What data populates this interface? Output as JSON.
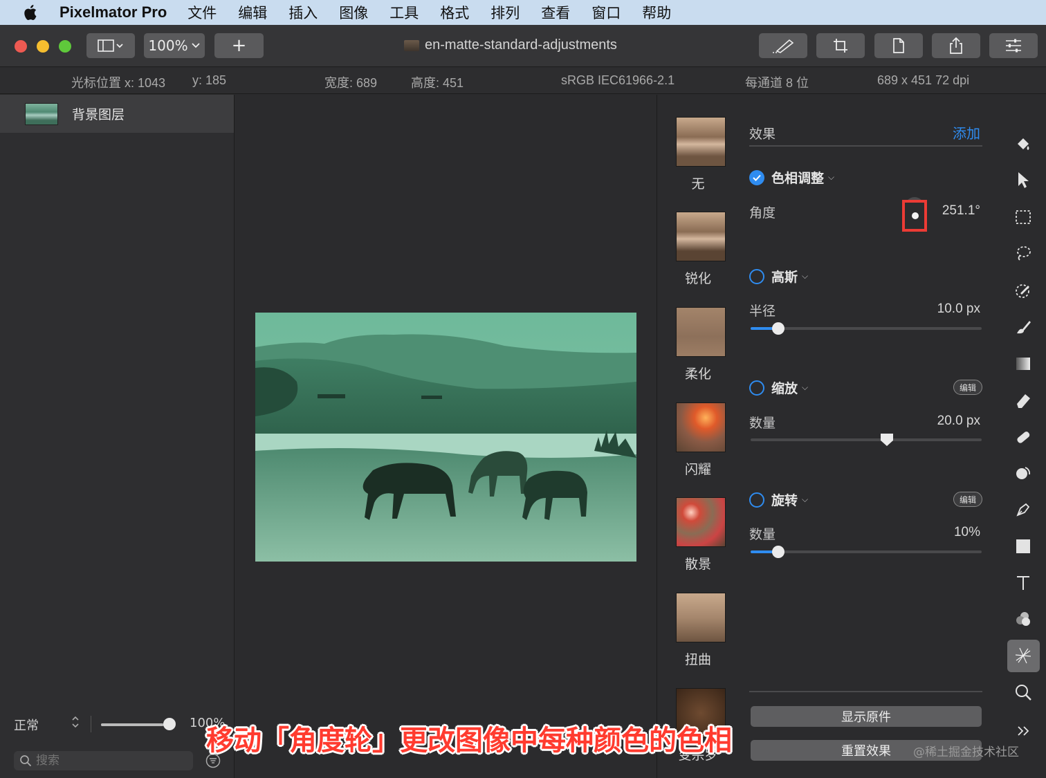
{
  "menubar": {
    "app_name": "Pixelmator Pro",
    "items": [
      "文件",
      "编辑",
      "插入",
      "图像",
      "工具",
      "格式",
      "排列",
      "查看",
      "窗口",
      "帮助"
    ]
  },
  "toolbar": {
    "zoom": "100%",
    "add_label": "+",
    "document_title": "en-matte-standard-adjustments"
  },
  "infobar": {
    "cursor_x": "光标位置 x:  1043",
    "cursor_y": "y:  185",
    "width": "宽度:  689",
    "height": "高度:  451",
    "color_profile": "sRGB IEC61966-2.1",
    "bit_depth": "每通道 8 位",
    "dimensions": "689 x 451 72 dpi"
  },
  "layers": {
    "items": [
      {
        "name": "背景图层"
      }
    ],
    "blend_mode": "正常",
    "opacity": "100%",
    "opacity_value": 1.0,
    "search_placeholder": "搜索"
  },
  "effects_browser": {
    "items": [
      "无",
      "锐化",
      "柔化",
      "闪耀",
      "散景",
      "扭曲",
      "变宗罗"
    ]
  },
  "effects_panel": {
    "header": "效果",
    "add_label": "添加",
    "effects": [
      {
        "name": "色相调整",
        "enabled": true,
        "param_label": "角度",
        "param_value": "251.1°"
      },
      {
        "name": "高斯",
        "enabled": false,
        "param_label": "半径",
        "param_value": "10.0 px",
        "slider_fraction": 0.12
      },
      {
        "name": "缩放",
        "enabled": false,
        "edit_label": "编辑",
        "param_label": "数量",
        "param_value": "20.0 px",
        "slider_fraction": 0.59
      },
      {
        "name": "旋转",
        "enabled": false,
        "edit_label": "编辑",
        "param_label": "数量",
        "param_value": "10%",
        "slider_fraction": 0.12
      }
    ],
    "show_original": "显示原件",
    "reset_effects": "重置效果"
  },
  "tools": [
    "paint-bucket-icon",
    "arrow-pointer-icon",
    "rect-select-icon",
    "lasso-icon",
    "color-picker-icon",
    "brush-icon",
    "gradient-icon",
    "eraser-icon",
    "bandage-icon",
    "rotate-icon",
    "pen-icon",
    "shape-icon",
    "type-icon",
    "color-adjust-icon",
    "effects-icon",
    "zoom-icon",
    "more-icon"
  ],
  "caption": "移动「角度轮」更改图像中每种颜色的色相",
  "watermark": "@稀土掘金技术社区",
  "colors": {
    "accent": "#2f8cf0",
    "highlight_box": "#ec3b35",
    "caption": "#ff3b2f"
  }
}
